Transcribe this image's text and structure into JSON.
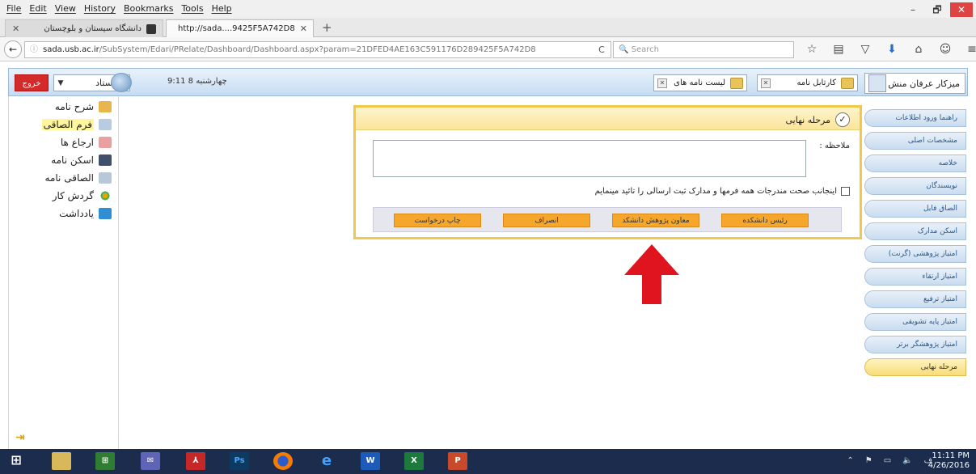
{
  "menubar": {
    "items": [
      "File",
      "Edit",
      "View",
      "History",
      "Bookmarks",
      "Tools",
      "Help"
    ]
  },
  "window_controls": {
    "minimize": "–",
    "maximize": "🗗",
    "close": "✕"
  },
  "tabs": [
    {
      "title": "دانشگاه سیستان و بلوچستان",
      "close": "✕"
    },
    {
      "title": "http://sada....9425F5A742D8",
      "close": "✕"
    }
  ],
  "new_tab": "+",
  "navbar": {
    "back": "←",
    "info": "ⓘ",
    "url_host": "sada.usb.ac.ir",
    "url_path": "/SubSystem/Edari/PRelate/Dashboard/Dashboard.aspx?param=21DFED4AE163C591176D289425F5A742D8",
    "reload": "C",
    "search_placeholder": "Search",
    "icons": [
      "star-icon",
      "reading-list-icon",
      "pocket-icon",
      "download-icon",
      "home-icon",
      "sync-icon",
      "menu-icon"
    ]
  },
  "app_toolbar": {
    "logout": "خروج",
    "role": "استاد",
    "datetime": "9:11 چهارشنبه 8",
    "tab_letters": "لیست نامه های",
    "tab_cartable": "کارتابل نامه",
    "user": "میزکار عرفان منش"
  },
  "left_panel": {
    "items": [
      {
        "label": "شرح نامه",
        "icon": "envelope-icon",
        "highlight": false
      },
      {
        "label": "فرم الصاقی",
        "icon": "form-icon",
        "highlight": true
      },
      {
        "label": "ارجاع ها",
        "icon": "referral-icon",
        "highlight": false
      },
      {
        "label": "اسکن نامه",
        "icon": "scanner-icon",
        "highlight": false
      },
      {
        "label": "الصاقی نامه",
        "icon": "attachment-icon",
        "highlight": false
      },
      {
        "label": "گردش کار",
        "icon": "workflow-icon",
        "highlight": false
      },
      {
        "label": "یادداشت",
        "icon": "notes-icon",
        "highlight": false
      }
    ]
  },
  "dialog": {
    "title": "مرحله نهایی",
    "note_label": "ملاحظه :",
    "confirm_text": "اینجانب صحت مندرجات همه فرمها و مدارک ثبت ارسالی را تائید مینمایم",
    "buttons": {
      "print": "چاپ درخواست",
      "cancel": "انصراف",
      "vice": "معاون پژوهش دانشکد",
      "dean": "رئیس دانشکده"
    }
  },
  "right_nav": {
    "items": [
      "راهنما ورود اطلاعات",
      "مشخصات اصلی",
      "خلاصه",
      "نویسندگان",
      "الصاق فایل",
      "اسکن مدارک",
      "امتیاز پژوهشی (گرنت)",
      "امتیاز ارتقاء",
      "امتیاز ترفیع",
      "امتیاز پایه تشویقی",
      "امتیاز پژوهشگر برتر",
      "مرحله نهایی"
    ],
    "active_index": 11
  },
  "taskbar": {
    "apps": [
      "file-explorer-icon",
      "store-icon",
      "mail-icon",
      "acrobat-icon",
      "photoshop-icon",
      "firefox-icon",
      "ie-icon",
      "word-icon",
      "excel-icon",
      "powerpoint-icon"
    ],
    "clock_time": "11:11 PM",
    "clock_date": "4/26/2016"
  },
  "colors": {
    "accent_orange": "#f6a62a",
    "dialog_border": "#f2c84b",
    "arrow_red": "#e0141e",
    "logout_red": "#d42a2a"
  }
}
